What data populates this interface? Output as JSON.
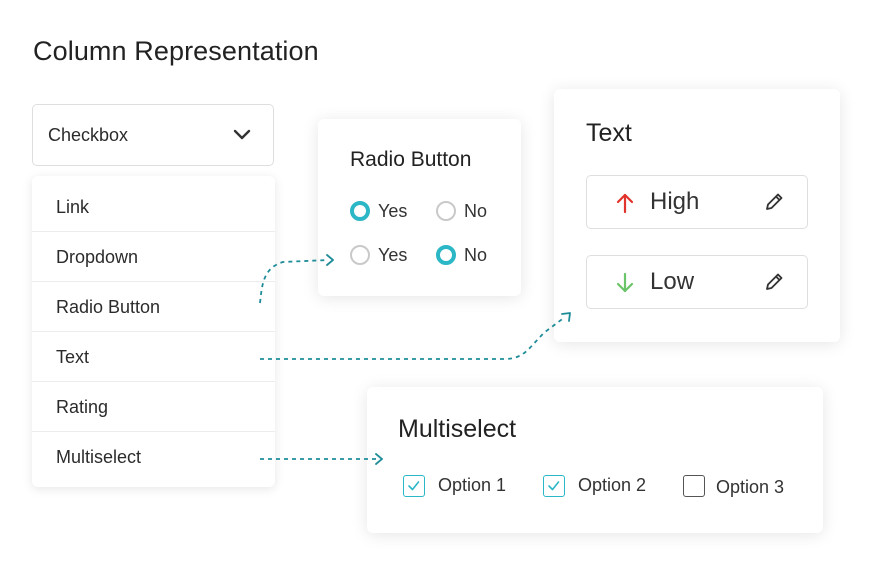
{
  "page_title": "Column Representation",
  "column_type_select": {
    "selected": "Checkbox"
  },
  "menu": {
    "items": [
      "Link",
      "Dropdown",
      "Radio Button",
      "Text",
      "Rating",
      "Multiselect"
    ]
  },
  "radio_card": {
    "title": "Radio Button",
    "rows": [
      {
        "yes_label": "Yes",
        "no_label": "No",
        "selected": "yes"
      },
      {
        "yes_label": "Yes",
        "no_label": "No",
        "selected": "no"
      }
    ]
  },
  "text_card": {
    "title": "Text",
    "rows": [
      {
        "label": "High",
        "direction": "up",
        "color": "#e0332b"
      },
      {
        "label": "Low",
        "direction": "down",
        "color": "#6ac46a"
      }
    ]
  },
  "multiselect_card": {
    "title": "Multiselect",
    "options": [
      {
        "label": "Option 1",
        "checked": true
      },
      {
        "label": "Option 2",
        "checked": true
      },
      {
        "label": "Option 3",
        "checked": false
      }
    ]
  },
  "colors": {
    "accent": "#2cb7c6",
    "connector": "#1f8d99"
  }
}
